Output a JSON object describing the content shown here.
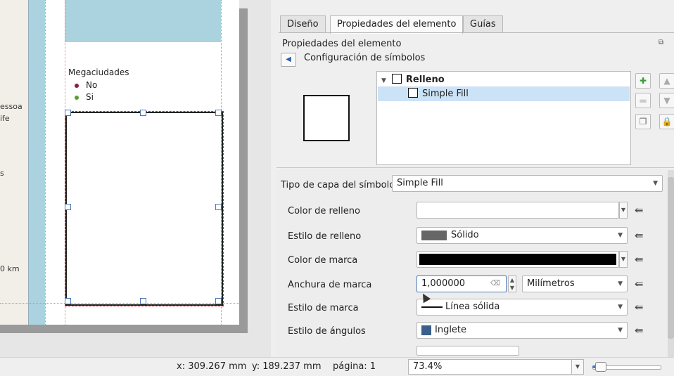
{
  "canvas": {
    "legend_title": "Megaciudades",
    "legend_items": [
      {
        "label": "No",
        "color": "#8b1c3c"
      },
      {
        "label": "Si",
        "color": "#5aa02c"
      }
    ],
    "map_labels": [
      "essoa",
      "ife",
      "s",
      "0 km"
    ]
  },
  "panel": {
    "tabs": [
      {
        "label": "Diseño"
      },
      {
        "label": "Propiedades del elemento"
      },
      {
        "label": "Guías"
      }
    ],
    "dock_title": "Propiedades del elemento",
    "breadcrumb": "Configuración de símbolos",
    "tree": {
      "root_label": "Relleno",
      "child_label": "Simple Fill"
    },
    "layer_type_label": "Tipo de capa del símbolo",
    "layer_type_value": "Simple Fill",
    "properties": {
      "fill_color_label": "Color de relleno",
      "fill_style_label": "Estilo de relleno",
      "fill_style_value": "Sólido",
      "stroke_color_label": "Color de marca",
      "stroke_width_label": "Anchura de marca",
      "stroke_width_value": "1,000000",
      "stroke_width_unit": "Milímetros",
      "stroke_style_label": "Estilo de marca",
      "stroke_style_value": "Línea sólida",
      "join_style_label": "Estilo de ángulos",
      "join_style_value": "Inglete"
    },
    "colors": {
      "fill_color": "#ffffff",
      "stroke_color": "#000000",
      "solid_swatch": "#666666"
    }
  },
  "status": {
    "x": "x: 309.267 mm",
    "y": "y: 189.237 mm",
    "page": "página: 1",
    "zoom": "73.4%"
  }
}
